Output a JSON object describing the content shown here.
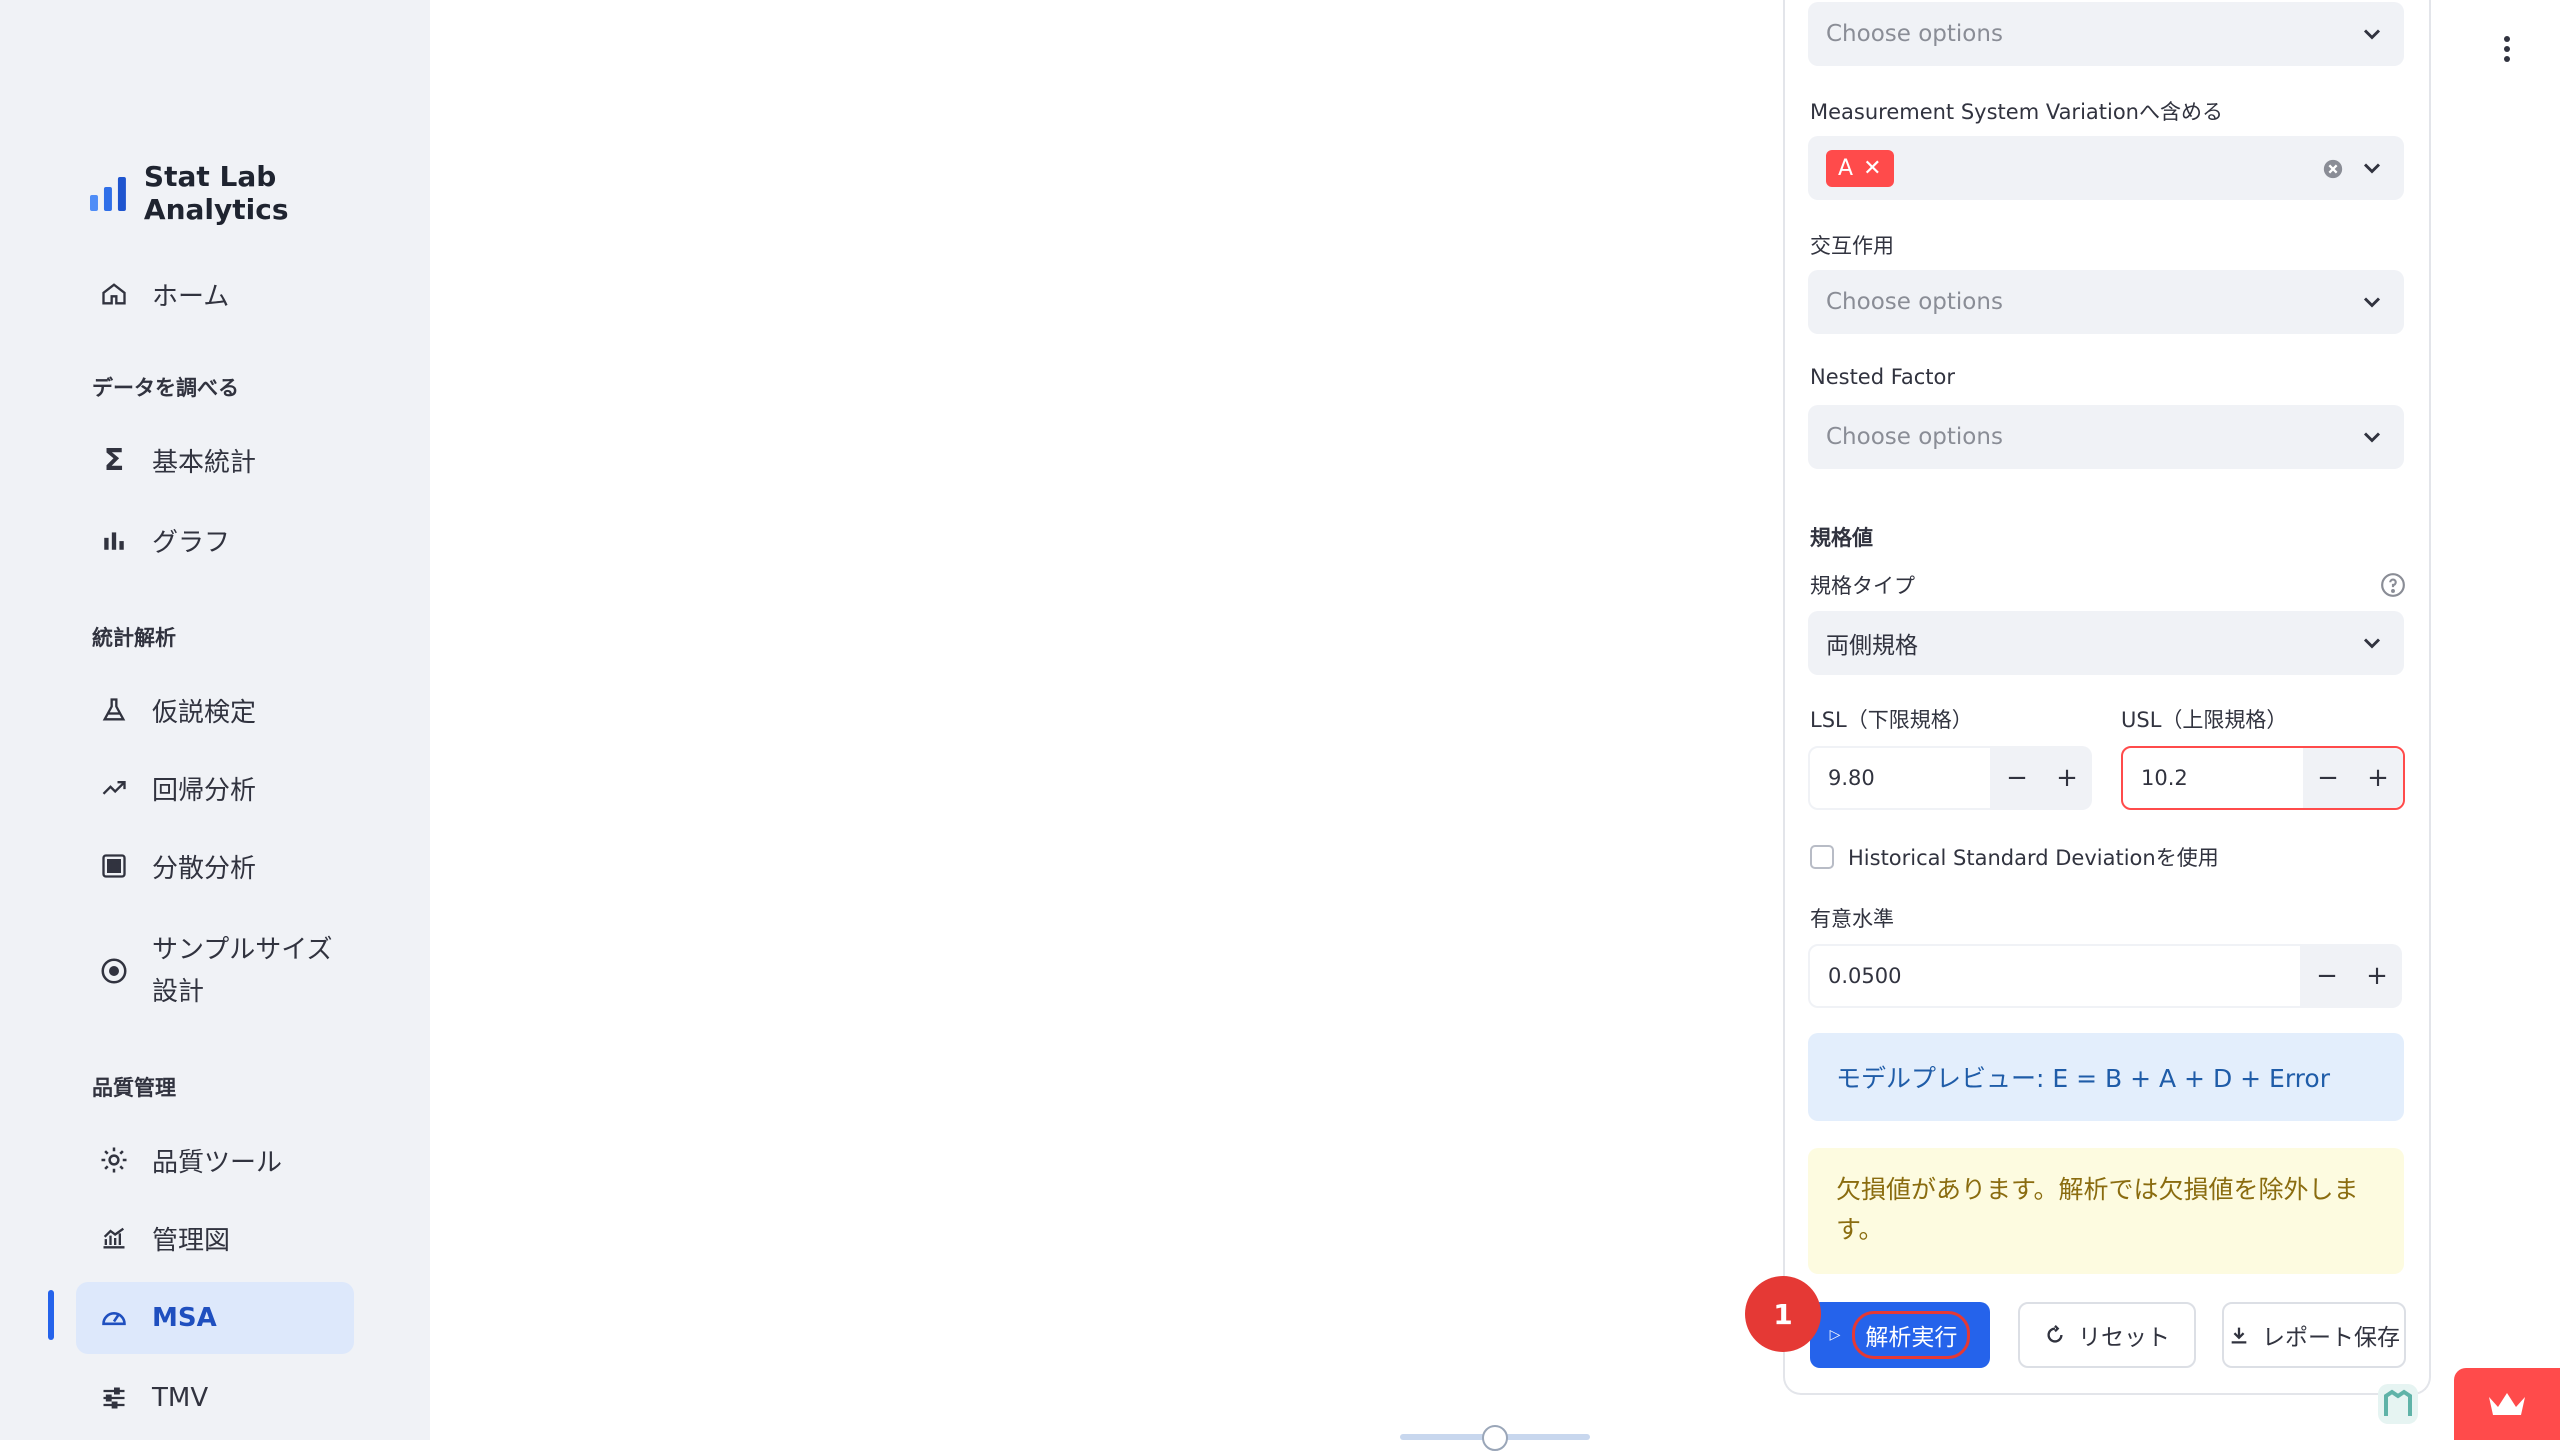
{
  "brand": {
    "name": "Stat Lab Analytics"
  },
  "sidebar": {
    "home": "ホーム",
    "section_explore": "データを調べる",
    "basic_stats": "基本統計",
    "graph": "グラフ",
    "section_stats": "統計解析",
    "hypothesis": "仮説検定",
    "regression": "回帰分析",
    "anova": "分散分析",
    "sample_size_1": "サンプルサイズ",
    "sample_size_2": "設計",
    "section_quality": "品質管理",
    "quality_tools": "品質ツール",
    "control_chart": "管理図",
    "msa": "MSA",
    "tmv": "TMV"
  },
  "form": {
    "top_select_placeholder": "Choose options",
    "msv_label": "Measurement System Variationへ含める",
    "msv_tag": "A",
    "interaction_label": "交互作用",
    "interaction_placeholder": "Choose options",
    "nested_label": "Nested Factor",
    "nested_placeholder": "Choose options",
    "spec_header": "規格値",
    "spec_type_label": "規格タイプ",
    "spec_type_value": "両側規格",
    "lsl_label": "LSL（下限規格）",
    "lsl_value": "9.80",
    "usl_label": "USL（上限規格）",
    "usl_value": "10.2",
    "historical_label": "Historical Standard Deviationを使用",
    "alpha_label": "有意水準",
    "alpha_value": "0.0500",
    "minus": "−",
    "plus": "+"
  },
  "info": {
    "model_preview": "モデルプレビュー: E = B + A + D + Error"
  },
  "warning": {
    "missing": "欠損値があります。解析では欠損値を除外します。"
  },
  "actions": {
    "run": "解析実行",
    "reset": "リセット",
    "save": "レポート保存",
    "step_badge": "1"
  },
  "colors": {
    "accent": "#2563eb",
    "danger": "#ff4b4b"
  }
}
